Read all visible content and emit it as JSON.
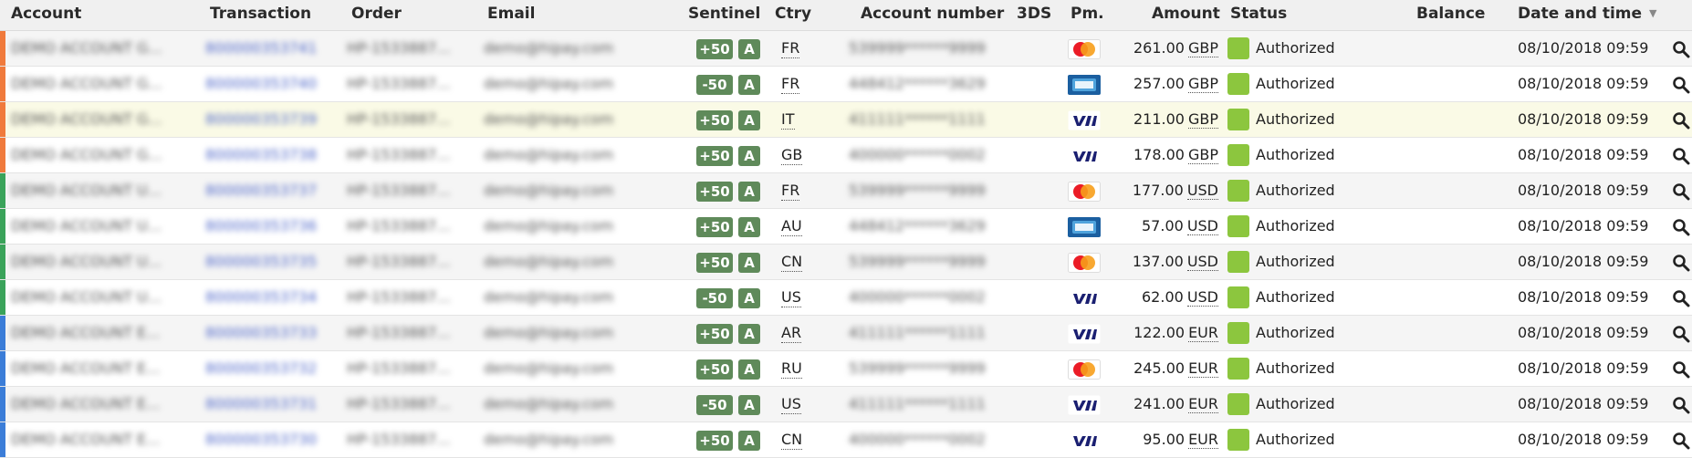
{
  "columns": {
    "account": "Account",
    "transaction": "Transaction",
    "order": "Order",
    "email": "Email",
    "sentinel": "Sentinel",
    "ctry": "Ctry",
    "account_number": "Account number",
    "threeds": "3DS",
    "pm": "Pm.",
    "amount": "Amount",
    "status": "Status",
    "balance": "Balance",
    "date": "Date and time"
  },
  "colors": {
    "accent_score": "#5f8a5a",
    "status_green": "#8cc63e",
    "link_blue": "#4a63c8",
    "stripe_orange": "#f07a3c",
    "stripe_green": "#3aa35a",
    "stripe_blue": "#3b7dd8"
  },
  "rows": [
    {
      "account": "DEMO ACCOUNT G...",
      "transaction": "800000353741",
      "order": "HP-1533887...",
      "email": "demo@hipay.com",
      "score": "+50",
      "grade": "A",
      "ctry": "FR",
      "account_number": "539999******9999",
      "pm": "mastercard",
      "amount": "261.00",
      "currency": "GBP",
      "status": "Authorized",
      "date": "08/10/2018 09:59",
      "stripe": "orange"
    },
    {
      "account": "DEMO ACCOUNT G...",
      "transaction": "800000353740",
      "order": "HP-1533887...",
      "email": "demo@hipay.com",
      "score": "-50",
      "grade": "A",
      "ctry": "FR",
      "account_number": "448412******3629",
      "pm": "cb",
      "amount": "257.00",
      "currency": "GBP",
      "status": "Authorized",
      "date": "08/10/2018 09:59",
      "stripe": "orange"
    },
    {
      "account": "DEMO ACCOUNT G...",
      "transaction": "800000353739",
      "order": "HP-1533887...",
      "email": "demo@hipay.com",
      "score": "+50",
      "grade": "A",
      "ctry": "IT",
      "account_number": "411111******1111",
      "pm": "visa",
      "amount": "211.00",
      "currency": "GBP",
      "status": "Authorized",
      "date": "08/10/2018 09:59",
      "stripe": "orange"
    },
    {
      "account": "DEMO ACCOUNT G...",
      "transaction": "800000353738",
      "order": "HP-1533887...",
      "email": "demo@hipay.com",
      "score": "+50",
      "grade": "A",
      "ctry": "GB",
      "account_number": "400000******0002",
      "pm": "visa",
      "amount": "178.00",
      "currency": "GBP",
      "status": "Authorized",
      "date": "08/10/2018 09:59",
      "stripe": "orange"
    },
    {
      "account": "DEMO ACCOUNT U...",
      "transaction": "800000353737",
      "order": "HP-1533887...",
      "email": "demo@hipay.com",
      "score": "+50",
      "grade": "A",
      "ctry": "FR",
      "account_number": "539999******9999",
      "pm": "mastercard",
      "amount": "177.00",
      "currency": "USD",
      "status": "Authorized",
      "date": "08/10/2018 09:59",
      "stripe": "green"
    },
    {
      "account": "DEMO ACCOUNT U...",
      "transaction": "800000353736",
      "order": "HP-1533887...",
      "email": "demo@hipay.com",
      "score": "+50",
      "grade": "A",
      "ctry": "AU",
      "account_number": "448412******3629",
      "pm": "cb",
      "amount": "57.00",
      "currency": "USD",
      "status": "Authorized",
      "date": "08/10/2018 09:59",
      "stripe": "green"
    },
    {
      "account": "DEMO ACCOUNT U...",
      "transaction": "800000353735",
      "order": "HP-1533887...",
      "email": "demo@hipay.com",
      "score": "+50",
      "grade": "A",
      "ctry": "CN",
      "account_number": "539999******9999",
      "pm": "mastercard",
      "amount": "137.00",
      "currency": "USD",
      "status": "Authorized",
      "date": "08/10/2018 09:59",
      "stripe": "green"
    },
    {
      "account": "DEMO ACCOUNT U...",
      "transaction": "800000353734",
      "order": "HP-1533887...",
      "email": "demo@hipay.com",
      "score": "-50",
      "grade": "A",
      "ctry": "US",
      "account_number": "400000******0002",
      "pm": "visa",
      "amount": "62.00",
      "currency": "USD",
      "status": "Authorized",
      "date": "08/10/2018 09:59",
      "stripe": "green"
    },
    {
      "account": "DEMO ACCOUNT E...",
      "transaction": "800000353733",
      "order": "HP-1533887...",
      "email": "demo@hipay.com",
      "score": "+50",
      "grade": "A",
      "ctry": "AR",
      "account_number": "411111******1111",
      "pm": "visa",
      "amount": "122.00",
      "currency": "EUR",
      "status": "Authorized",
      "date": "08/10/2018 09:59",
      "stripe": "blue"
    },
    {
      "account": "DEMO ACCOUNT E...",
      "transaction": "800000353732",
      "order": "HP-1533887...",
      "email": "demo@hipay.com",
      "score": "+50",
      "grade": "A",
      "ctry": "RU",
      "account_number": "539999******9999",
      "pm": "mastercard",
      "amount": "245.00",
      "currency": "EUR",
      "status": "Authorized",
      "date": "08/10/2018 09:59",
      "stripe": "blue"
    },
    {
      "account": "DEMO ACCOUNT E...",
      "transaction": "800000353731",
      "order": "HP-1533887...",
      "email": "demo@hipay.com",
      "score": "-50",
      "grade": "A",
      "ctry": "US",
      "account_number": "411111******1111",
      "pm": "visa",
      "amount": "241.00",
      "currency": "EUR",
      "status": "Authorized",
      "date": "08/10/2018 09:59",
      "stripe": "blue"
    },
    {
      "account": "DEMO ACCOUNT E...",
      "transaction": "800000353730",
      "order": "HP-1533887...",
      "email": "demo@hipay.com",
      "score": "+50",
      "grade": "A",
      "ctry": "CN",
      "account_number": "400000******0002",
      "pm": "visa",
      "amount": "95.00",
      "currency": "EUR",
      "status": "Authorized",
      "date": "08/10/2018 09:59",
      "stripe": "blue"
    }
  ]
}
